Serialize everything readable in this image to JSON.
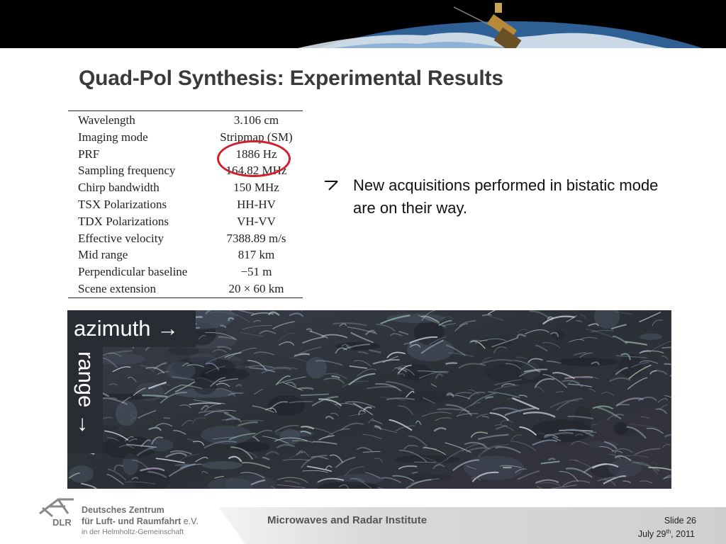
{
  "title": "Quad-Pol Synthesis: Experimental Results",
  "parameters": [
    {
      "label": "Wavelength",
      "value": "3.106 cm"
    },
    {
      "label": "Imaging mode",
      "value": "Stripmap (SM)"
    },
    {
      "label": "PRF",
      "value": "1886 Hz"
    },
    {
      "label": "Sampling frequency",
      "value": "164.82 MHz"
    },
    {
      "label": "Chirp bandwidth",
      "value": "150 MHz"
    },
    {
      "label": "TSX Polarizations",
      "value": "HH-HV"
    },
    {
      "label": "TDX Polarizations",
      "value": "VH-VV"
    },
    {
      "label": "Effective velocity",
      "value": "7388.89 m/s"
    },
    {
      "label": "Mid range",
      "value": "817 km"
    },
    {
      "label": "Perpendicular baseline",
      "value": "−51 m"
    },
    {
      "label": "Scene extension",
      "value": "20 × 60 km"
    }
  ],
  "highlighted_parameter": "PRF",
  "highlight_color": "#d21f2e",
  "bullet": {
    "icon": "arrow-bullet-icon",
    "text": "New acquisitions performed in bistatic mode are on their way."
  },
  "image_labels": {
    "azimuth": "azimuth →",
    "range": "range →"
  },
  "footer": {
    "logo_abbrev": "DLR",
    "logo_line1": "Deutsches Zentrum",
    "logo_line2": "für Luft- und Raumfahrt",
    "logo_line2_suffix": " e.V.",
    "logo_line3": "in der Helmholtz-Gemeinschaft",
    "institute": "Microwaves and Radar Institute",
    "slide_label": "Slide 26",
    "date_prefix": "July 29",
    "date_sup": "th",
    "date_suffix": ", 2011"
  }
}
